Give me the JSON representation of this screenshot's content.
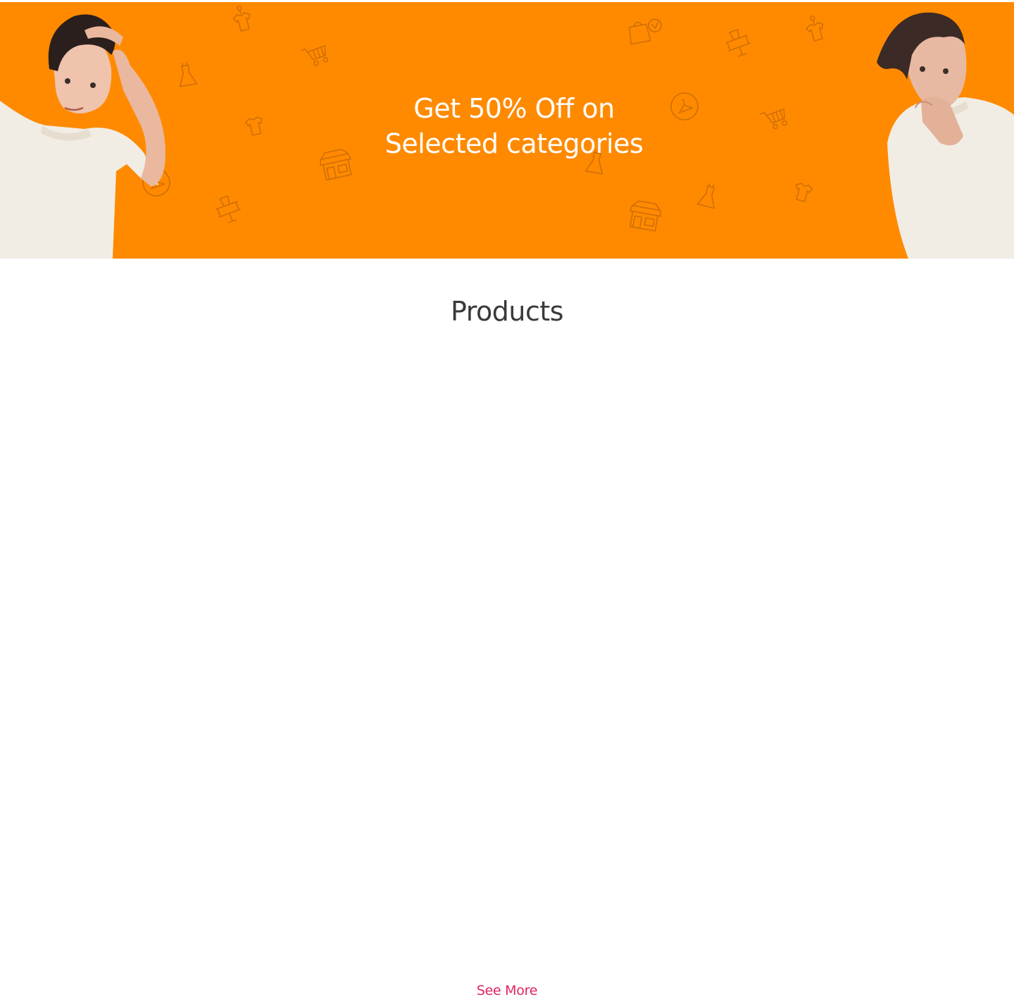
{
  "banner": {
    "headline_line1": "Get 50%  Off on",
    "headline_line2": "Selected categories",
    "background_color": "#ff8a00",
    "pattern_icons": [
      "tshirt-icon",
      "shopping-cart-icon",
      "dress-icon",
      "storefront-icon",
      "hanger-icon",
      "mannequin-icon",
      "shopping-bags-icon"
    ]
  },
  "products": {
    "title": "Products",
    "items": []
  },
  "see_more": {
    "label": "See More",
    "color": "#e0245e"
  }
}
